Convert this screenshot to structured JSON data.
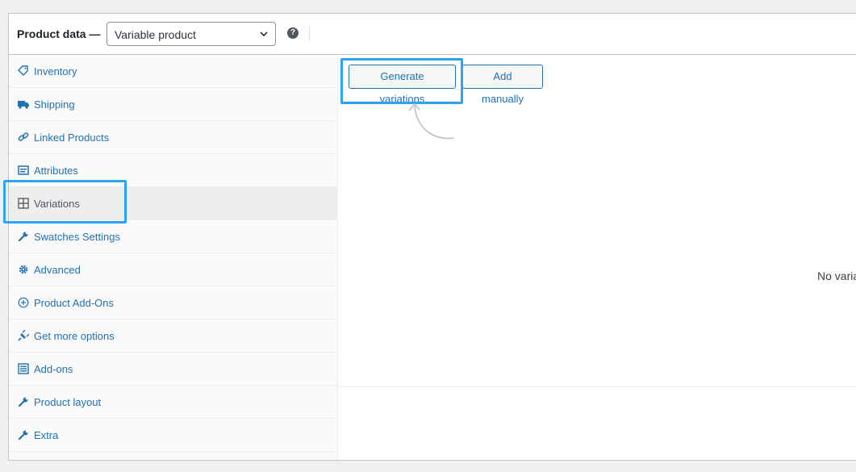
{
  "header": {
    "title": "Product data —",
    "product_type": "Variable product",
    "help_icon": "question-circle-icon"
  },
  "tabs": [
    {
      "label": "Inventory",
      "icon": "tag-icon",
      "active": false
    },
    {
      "label": "Shipping",
      "icon": "truck-icon",
      "active": false
    },
    {
      "label": "Linked Products",
      "icon": "link-icon",
      "active": false
    },
    {
      "label": "Attributes",
      "icon": "list-card-icon",
      "active": false
    },
    {
      "label": "Variations",
      "icon": "grid-icon",
      "active": true
    },
    {
      "label": "Swatches Settings",
      "icon": "wrench-icon",
      "active": false
    },
    {
      "label": "Advanced",
      "icon": "gear-icon",
      "active": false
    },
    {
      "label": "Product Add-Ons",
      "icon": "plus-circle-icon",
      "active": false
    },
    {
      "label": "Get more options",
      "icon": "plug-icon",
      "active": false
    },
    {
      "label": "Add-ons",
      "icon": "list-icon",
      "active": false
    },
    {
      "label": "Product layout",
      "icon": "wrench-icon",
      "active": false
    },
    {
      "label": "Extra",
      "icon": "wrench-icon",
      "active": false
    }
  ],
  "variations": {
    "generate_label": "Generate variations",
    "add_manually_label": "Add manually",
    "empty_message": "No variati"
  },
  "colors": {
    "link": "#2271b1",
    "highlight": "#2ea3f2",
    "active_tab_bg": "#eeeeee"
  }
}
